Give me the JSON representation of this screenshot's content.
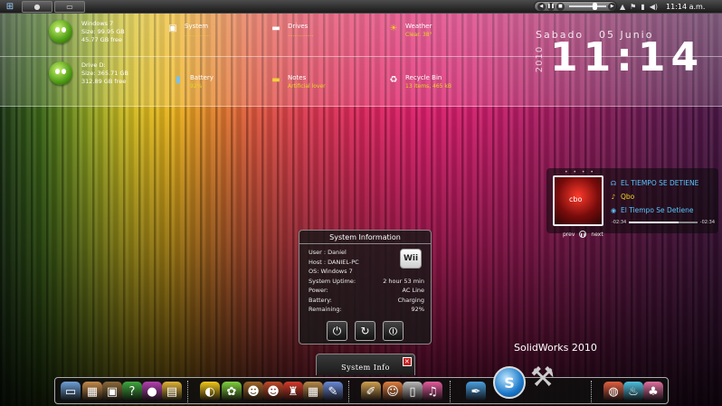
{
  "taskbar": {
    "start_icon": "windows-orb",
    "pinned": [
      {
        "icon": "media-player-icon",
        "glyph": "●"
      },
      {
        "icon": "explorer-icon",
        "glyph": "▭"
      }
    ],
    "media_glyphs": [
      "◀",
      "❚❚",
      "■",
      "▶"
    ],
    "tray_glyphs": [
      "▲",
      "⚑",
      "▮",
      "◀)"
    ],
    "time": "11:14 a.m."
  },
  "drives": [
    {
      "name": "Windows 7",
      "size": "Size: 99.95 GB",
      "free": "45.77 GB free"
    },
    {
      "name": "Drive D:",
      "size": "Size: 365.71 GB",
      "free": "312.89 GB free"
    }
  ],
  "widgets": {
    "system": {
      "title": "System",
      "sub": "...............",
      "icon": "monitor-icon",
      "glyph": "▣"
    },
    "drives": {
      "title": "Drives",
      "sub": "...............",
      "icon": "drive-icon",
      "glyph": "▬"
    },
    "weather": {
      "title": "Weather",
      "sub": "Clear. 38°",
      "icon": "sun-icon",
      "glyph": "☀"
    },
    "battery": {
      "title": "Battery",
      "sub": "92%",
      "icon": "battery-icon",
      "glyph": "▮"
    },
    "notes": {
      "title": "Notes",
      "sub": "Artificial lover",
      "icon": "notes-icon",
      "glyph": "▬"
    },
    "recycle": {
      "title": "Recycle Bin",
      "sub": "13 items, 465 kB",
      "icon": "recycle-bin-icon",
      "glyph": "♻"
    }
  },
  "bigclock": {
    "day": "Sabado",
    "date": "05 Junio",
    "year": "2010",
    "time": "11:14"
  },
  "player": {
    "dots": "• • • •",
    "cover_text": "cbo",
    "title": "EL TIEMPO SE DETIENE",
    "artist": "Qbo",
    "album": "El Tiempo Se Detiene",
    "elapsed": "-02:34",
    "remaining": "-02:34",
    "progress": 0.72,
    "prev": "prev",
    "next": "next",
    "icons": {
      "headphones": "☊",
      "mic": "♪",
      "disc": "◉",
      "pause": "❚❚"
    }
  },
  "sysinfo": {
    "header": "System Information",
    "logo": "Wii",
    "rows": [
      {
        "label": "User : Daniel",
        "value": ""
      },
      {
        "label": "Host : DANIEL-PC",
        "value": ""
      },
      {
        "label": "OS: Windows 7",
        "value": ""
      },
      {
        "label": "System Uptime:",
        "value": "2 hour 53 min"
      },
      {
        "label": "Power:",
        "value": "AC Line"
      },
      {
        "label": "Battery:",
        "value": "Charging"
      },
      {
        "label": "Remaining:",
        "value": "92%"
      }
    ],
    "buttons": [
      {
        "icon": "shutdown-icon",
        "glyph": "⏻"
      },
      {
        "icon": "restart-icon",
        "glyph": "↻"
      },
      {
        "icon": "logoff-icon",
        "glyph": "⏼"
      }
    ],
    "tab_label": "System Info",
    "close_glyph": "✕"
  },
  "solidworks_label": "SolidWorks 2010",
  "dock": {
    "icons": [
      {
        "icon": "imac-icon",
        "glyph": "▭",
        "color": "#6fa0d8"
      },
      {
        "icon": "box-icon",
        "glyph": "▦",
        "color": "#c58a4a"
      },
      {
        "icon": "photos-icon",
        "glyph": "▣",
        "color": "#8b6a3a"
      },
      {
        "icon": "mario-block-icon",
        "glyph": "?",
        "color": "#3fa83f"
      },
      {
        "icon": "fruit-icon",
        "glyph": "●",
        "color": "#b53fb1"
      },
      {
        "icon": "toolbox-icon",
        "glyph": "▤",
        "color": "#e0b23a"
      },
      {
        "icon": "pacman-icon",
        "glyph": "◐",
        "color": "#f2c81d"
      },
      {
        "icon": "lollipop-icon",
        "glyph": "✿",
        "color": "#7fd23d"
      },
      {
        "icon": "monkey-icon",
        "glyph": "☻",
        "color": "#a0662a"
      },
      {
        "icon": "monkey-2-icon",
        "glyph": "☻",
        "color": "#c04a2a"
      },
      {
        "icon": "mario-icon",
        "glyph": "♜",
        "color": "#d43a2a"
      },
      {
        "icon": "crate-icon",
        "glyph": "▦",
        "color": "#b88a4a"
      },
      {
        "icon": "feather-icon",
        "glyph": "✎",
        "color": "#6a8ad8"
      },
      {
        "icon": "pencil-cup-icon",
        "glyph": "✐",
        "color": "#d0a050"
      },
      {
        "icon": "character-icon",
        "glyph": "☺",
        "color": "#e08040"
      },
      {
        "icon": "bottle-icon",
        "glyph": "▯",
        "color": "#bbbbbb"
      },
      {
        "icon": "itunes-icon",
        "glyph": "♫",
        "color": "#e35b9e"
      },
      {
        "icon": "pen-icon",
        "glyph": "✒",
        "color": "#4aa0e0"
      },
      {
        "icon": "color-wheel-icon",
        "glyph": "◍",
        "color": "#e06040"
      },
      {
        "icon": "potion-icon",
        "glyph": "♨",
        "color": "#50c0e0"
      },
      {
        "icon": "cake-icon",
        "glyph": "♣",
        "color": "#e070a0"
      }
    ],
    "special": [
      {
        "icon": "solidworks-icon",
        "glyph": "S"
      },
      {
        "icon": "wrench-icon",
        "glyph": "🔧"
      }
    ]
  }
}
